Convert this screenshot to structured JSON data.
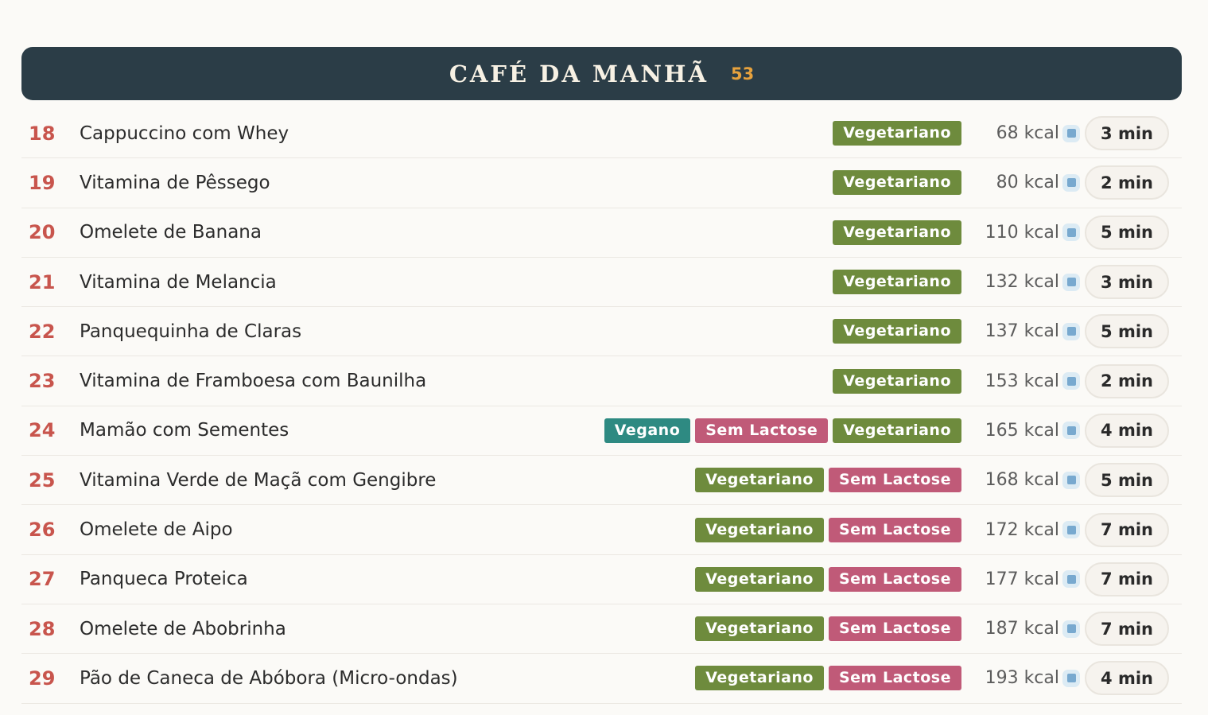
{
  "section": {
    "title": "CAFÉ DA MANHÃ",
    "count": "53"
  },
  "colors": {
    "header_bg": "#2b3d47",
    "count": "#e7a23d",
    "number": "#c8554d",
    "Vegetariano": "#6e8b3d",
    "Vegano": "#2e8a82",
    "Sem Lactose": "#c05a78"
  },
  "icons": {
    "kcal_marker": "blue-square-icon"
  },
  "recipes": [
    {
      "number": "18",
      "name": "Cappuccino com Whey",
      "tags": [
        "Vegetariano"
      ],
      "kcal": "68 kcal",
      "time": "3 min"
    },
    {
      "number": "19",
      "name": "Vitamina de Pêssego",
      "tags": [
        "Vegetariano"
      ],
      "kcal": "80 kcal",
      "time": "2 min"
    },
    {
      "number": "20",
      "name": "Omelete de Banana",
      "tags": [
        "Vegetariano"
      ],
      "kcal": "110 kcal",
      "time": "5 min"
    },
    {
      "number": "21",
      "name": "Vitamina de Melancia",
      "tags": [
        "Vegetariano"
      ],
      "kcal": "132 kcal",
      "time": "3 min"
    },
    {
      "number": "22",
      "name": "Panquequinha de Claras",
      "tags": [
        "Vegetariano"
      ],
      "kcal": "137 kcal",
      "time": "5 min"
    },
    {
      "number": "23",
      "name": "Vitamina de Framboesa com Baunilha",
      "tags": [
        "Vegetariano"
      ],
      "kcal": "153 kcal",
      "time": "2 min"
    },
    {
      "number": "24",
      "name": "Mamão com Sementes",
      "tags": [
        "Vegano",
        "Sem Lactose",
        "Vegetariano"
      ],
      "kcal": "165 kcal",
      "time": "4 min"
    },
    {
      "number": "25",
      "name": "Vitamina Verde de Maçã com Gengibre",
      "tags": [
        "Vegetariano",
        "Sem Lactose"
      ],
      "kcal": "168 kcal",
      "time": "5 min"
    },
    {
      "number": "26",
      "name": "Omelete de Aipo",
      "tags": [
        "Vegetariano",
        "Sem Lactose"
      ],
      "kcal": "172 kcal",
      "time": "7 min"
    },
    {
      "number": "27",
      "name": "Panqueca Proteica",
      "tags": [
        "Vegetariano",
        "Sem Lactose"
      ],
      "kcal": "177 kcal",
      "time": "7 min"
    },
    {
      "number": "28",
      "name": "Omelete de Abobrinha",
      "tags": [
        "Vegetariano",
        "Sem Lactose"
      ],
      "kcal": "187 kcal",
      "time": "7 min"
    },
    {
      "number": "29",
      "name": "Pão de Caneca de Abóbora (Micro-ondas)",
      "tags": [
        "Vegetariano",
        "Sem Lactose"
      ],
      "kcal": "193 kcal",
      "time": "4 min"
    }
  ]
}
